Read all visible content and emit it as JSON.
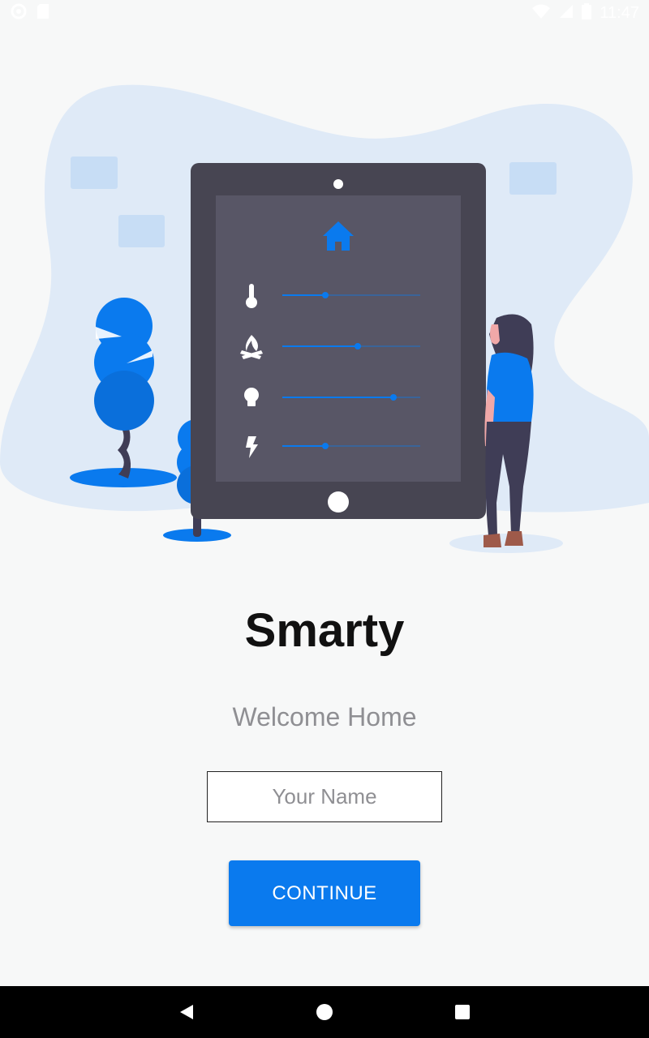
{
  "status_bar": {
    "time": "11:47",
    "left_icons": [
      "circle-icon",
      "sd-card-icon"
    ],
    "right_icons": [
      "wifi-icon",
      "signal-icon",
      "battery-icon"
    ]
  },
  "illustration": {
    "colors": {
      "blob": "#dfeaf7",
      "tablet_frame": "#474552",
      "tablet_screen": "#585666",
      "accent": "#0a7aee",
      "tile": "#c7ddf5"
    },
    "controls": [
      {
        "icon": "thermometer-icon",
        "level": 0.3
      },
      {
        "icon": "fire-icon",
        "level": 0.55
      },
      {
        "icon": "lightbulb-icon",
        "level": 0.85
      },
      {
        "icon": "lightning-icon",
        "level": 0.3
      }
    ],
    "header_icon": "home-icon"
  },
  "main": {
    "title": "Smarty",
    "subtitle": "Welcome Home",
    "name_placeholder": "Your Name",
    "name_value": "",
    "continue_label": "CONTINUE"
  },
  "nav_bar": {
    "buttons": [
      "back-icon",
      "home-icon",
      "recents-icon"
    ]
  },
  "colors": {
    "primary": "#0a7aee",
    "background": "#f7f8f8",
    "title": "#111111",
    "subtitle": "#8f8f93"
  }
}
